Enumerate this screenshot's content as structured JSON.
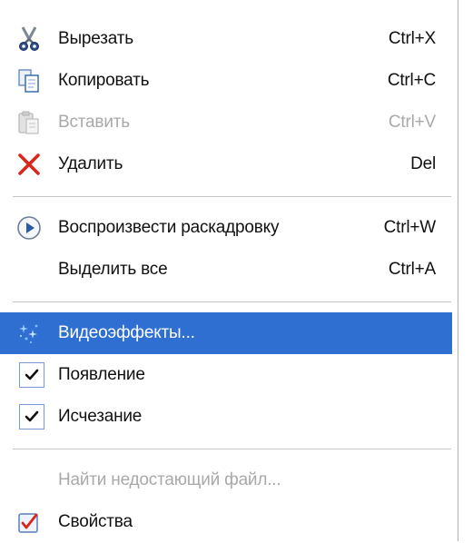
{
  "menu": {
    "items": [
      {
        "label": "Вырезать",
        "shortcut": "Ctrl+X",
        "icon": "scissors-icon",
        "enabled": true
      },
      {
        "label": "Копировать",
        "shortcut": "Ctrl+C",
        "icon": "copy-icon",
        "enabled": true
      },
      {
        "label": "Вставить",
        "shortcut": "Ctrl+V",
        "icon": "paste-icon",
        "enabled": false
      },
      {
        "label": "Удалить",
        "shortcut": "Del",
        "icon": "delete-x-icon",
        "enabled": true
      },
      {
        "label": "Воспроизвести раскадровку",
        "shortcut": "Ctrl+W",
        "icon": "play-icon",
        "enabled": true
      },
      {
        "label": "Выделить все",
        "shortcut": "Ctrl+A",
        "enabled": true
      },
      {
        "label": "Видеоэффекты...",
        "icon": "sparkle-effects-icon",
        "enabled": true,
        "highlighted": true
      },
      {
        "label": "Появление",
        "icon": "checkmark-icon",
        "checked": true,
        "enabled": true
      },
      {
        "label": "Исчезание",
        "icon": "checkmark-icon",
        "checked": true,
        "enabled": true
      },
      {
        "label": "Найти недостающий файл...",
        "enabled": false
      },
      {
        "label": "Свойства",
        "icon": "properties-checkbox-icon",
        "enabled": true
      }
    ]
  },
  "colors": {
    "highlight": "#2f6fd1",
    "disabled_text": "#a9a9a9",
    "delete_red": "#d9261c",
    "separator": "#c5c5c5"
  }
}
